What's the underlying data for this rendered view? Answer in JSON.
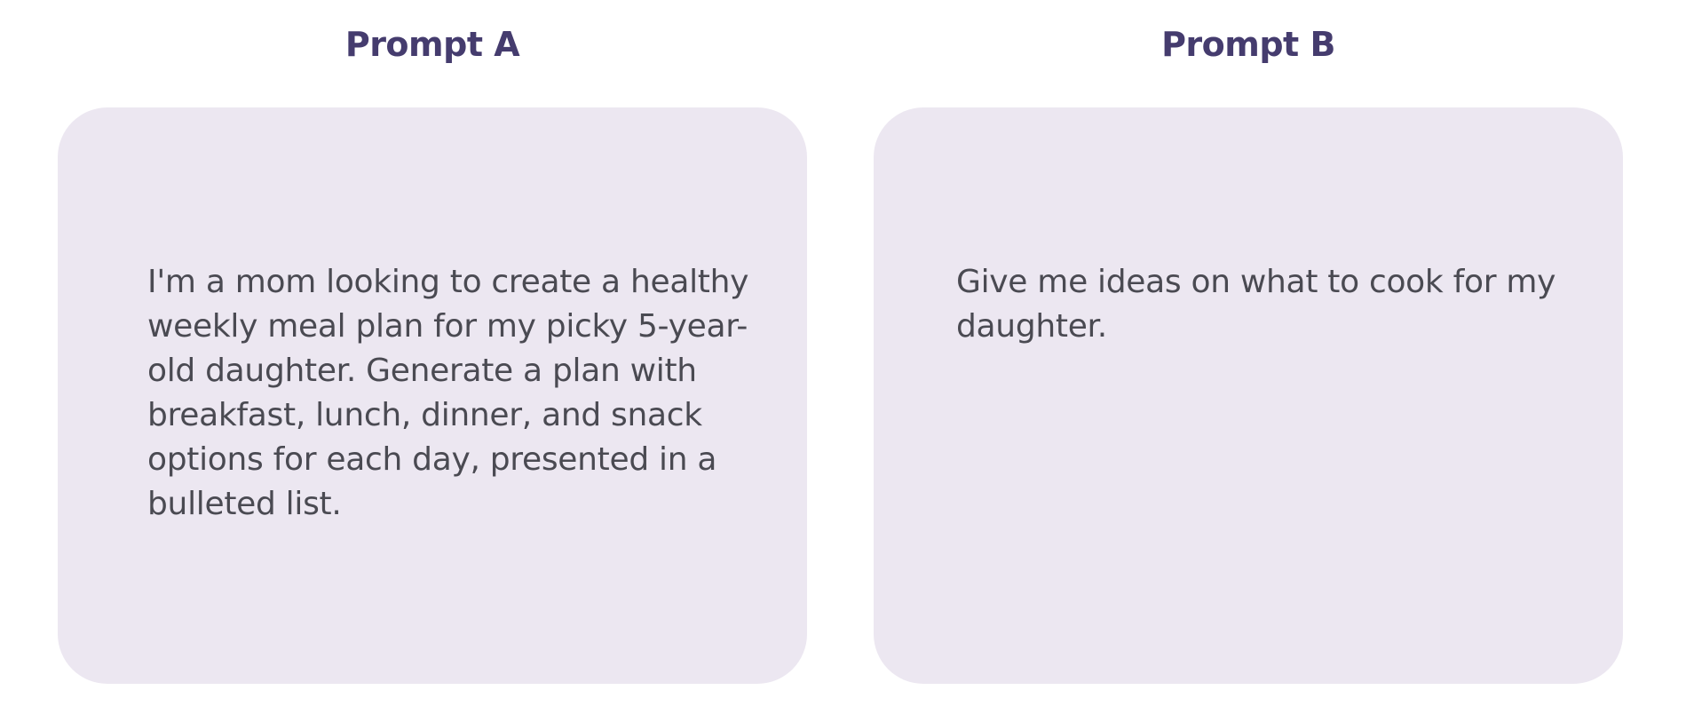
{
  "prompts": [
    {
      "title": "Prompt A",
      "text": "I'm a mom looking to create a healthy weekly meal plan for my picky 5-year-old daughter. Generate a plan with breakfast, lunch, dinner, and snack options for each day, presented in a bulleted list."
    },
    {
      "title": "Prompt B",
      "text": "Give me ideas on what to cook for my daughter."
    }
  ],
  "colors": {
    "title": "#453C6E",
    "card_background": "#ECE7F1",
    "card_text": "#4A4A52"
  }
}
